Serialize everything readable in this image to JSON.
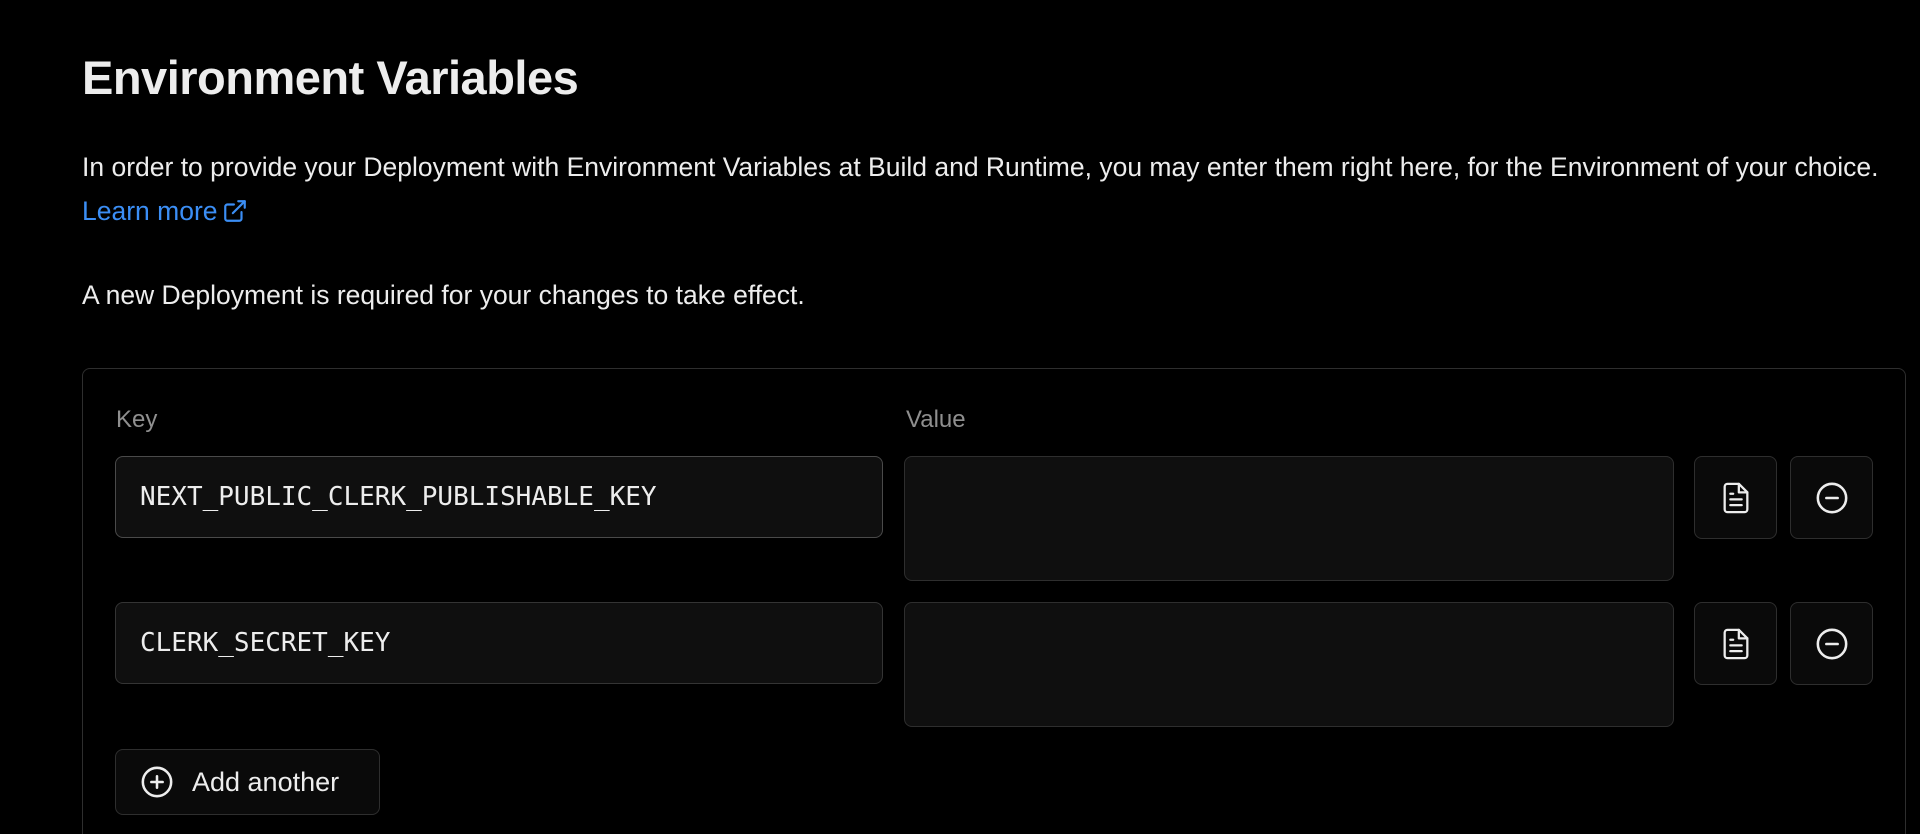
{
  "header": {
    "title": "Environment Variables",
    "description": "In order to provide your Deployment with Environment Variables at Build and Runtime, you may enter them right here, for the Environment of your choice.",
    "learn_more_label": "Learn more",
    "learn_more_icon": "external-link-icon",
    "notice": "A new Deployment is required for your changes to take effect."
  },
  "form": {
    "key_label": "Key",
    "value_label": "Value",
    "rows": [
      {
        "key": "NEXT_PUBLIC_CLERK_PUBLISHABLE_KEY",
        "value": ""
      },
      {
        "key": "CLERK_SECRET_KEY",
        "value": ""
      }
    ],
    "row_icons": {
      "file": "file-text-icon",
      "remove": "minus-circle-icon"
    },
    "add_another_label": "Add another",
    "add_icon": "plus-circle-icon"
  },
  "colors": {
    "background": "#000000",
    "text": "#ededed",
    "muted": "#8f8f8f",
    "link": "#3b8ef5",
    "border": "#2e2e2e",
    "input_bg": "#0f0f0f"
  }
}
